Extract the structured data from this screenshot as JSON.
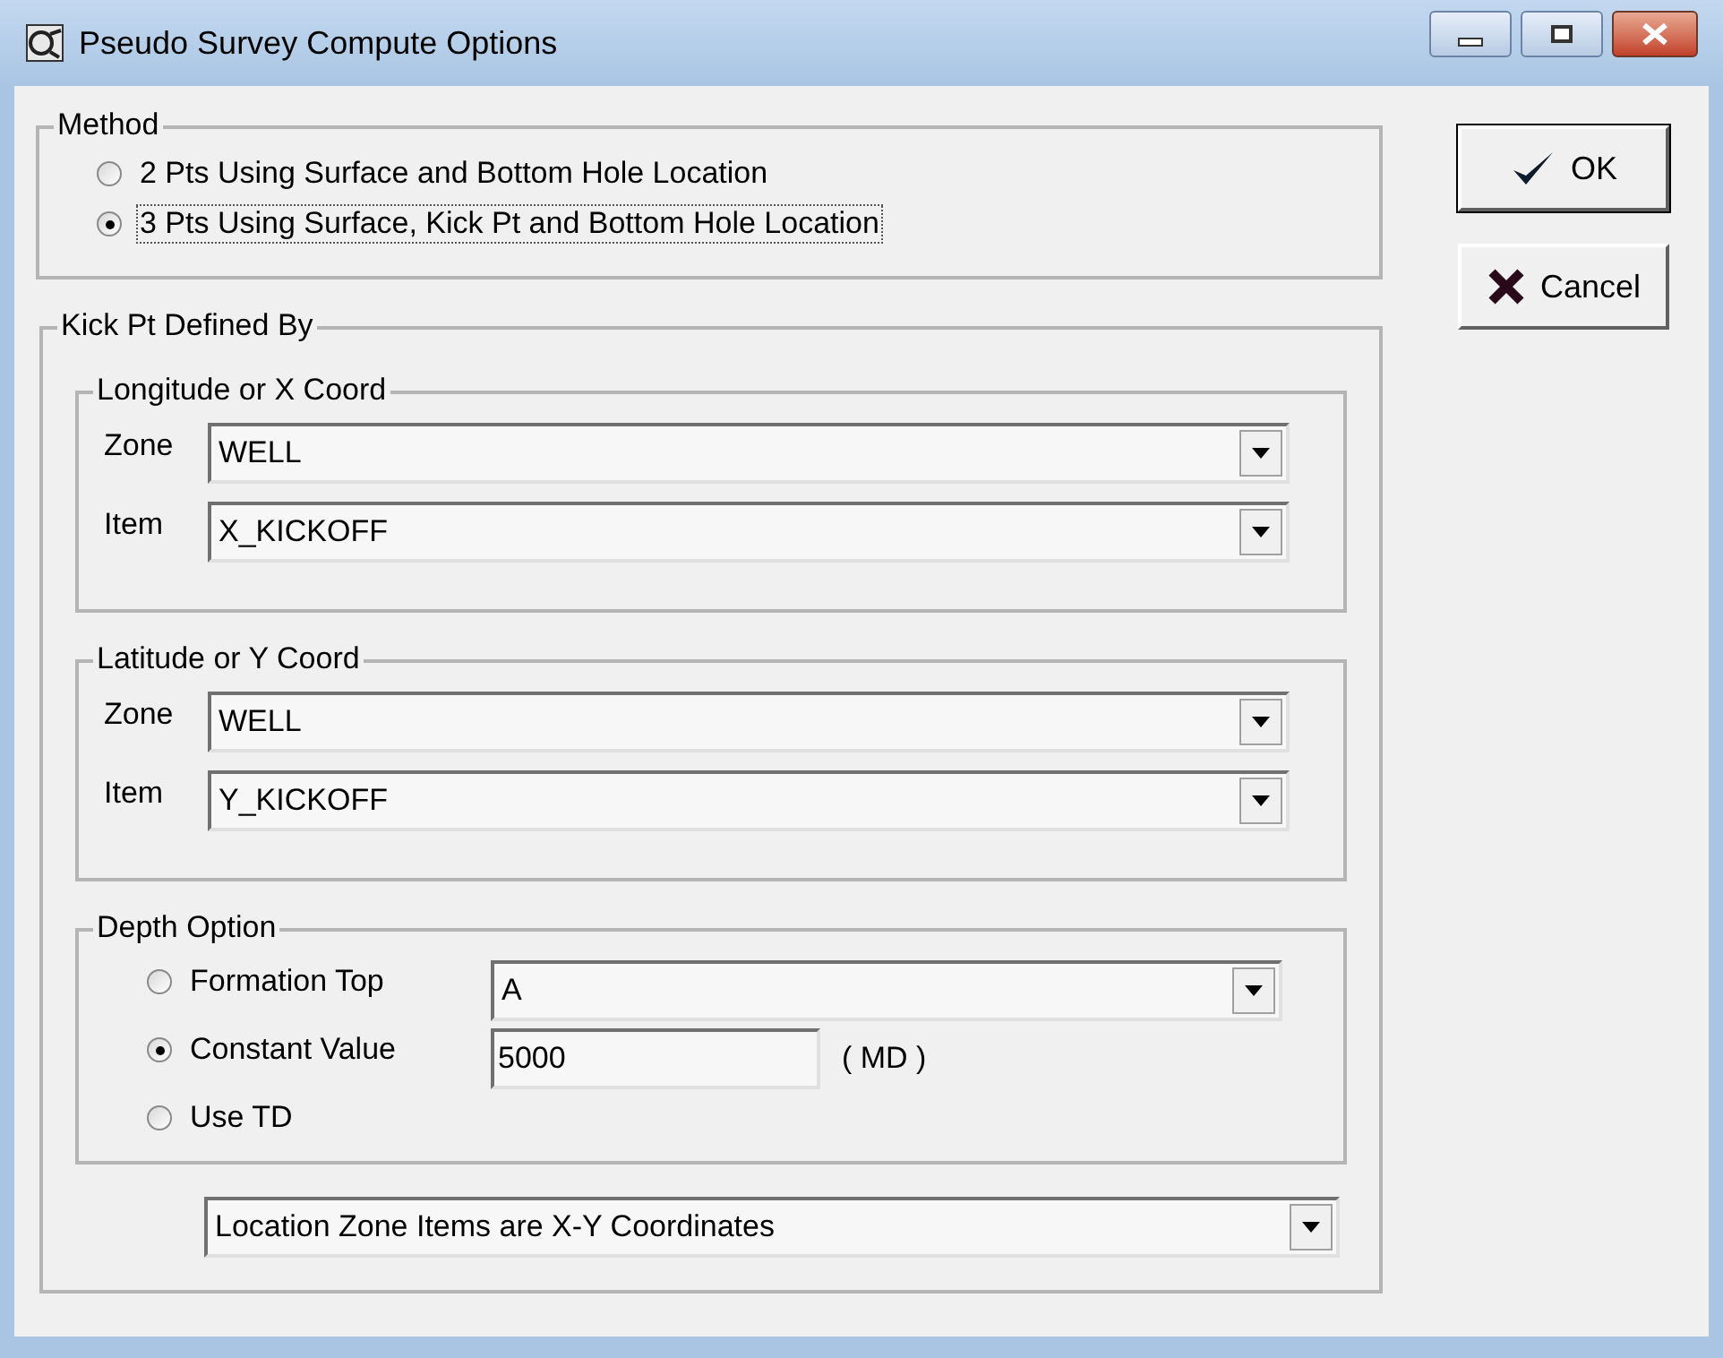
{
  "window": {
    "title": "Pseudo Survey Compute Options"
  },
  "method": {
    "title": "Method",
    "options": [
      {
        "label": "2 Pts Using Surface and Bottom Hole Location",
        "selected": false,
        "focused": false
      },
      {
        "label": "3 Pts Using Surface, Kick Pt and Bottom Hole Location",
        "selected": true,
        "focused": true
      }
    ]
  },
  "kick_pt": {
    "title": "Kick Pt Defined By",
    "groups": [
      {
        "title": "Longitude or X Coord",
        "fields": [
          {
            "label": "Zone",
            "value": "WELL"
          },
          {
            "label": "Item",
            "value": "X_KICKOFF"
          }
        ]
      },
      {
        "title": "Latitude or Y Coord",
        "fields": [
          {
            "label": "Zone",
            "value": "WELL"
          },
          {
            "label": "Item",
            "value": "Y_KICKOFF"
          }
        ]
      }
    ],
    "depth_option": {
      "title": "Depth Option",
      "options": [
        {
          "label": "Formation Top",
          "selected": false,
          "kind": "dropdown",
          "value": "A"
        },
        {
          "label": "Constant Value",
          "selected": true,
          "kind": "input",
          "value": "5000",
          "unit": "( MD )"
        },
        {
          "label": "Use TD",
          "selected": false,
          "kind": "none"
        }
      ]
    },
    "location_dropdown": {
      "value": "Location Zone Items are X-Y Coordinates"
    }
  },
  "buttons": [
    {
      "label": "OK",
      "kind": "ok"
    },
    {
      "label": "Cancel",
      "kind": "cancel"
    }
  ]
}
